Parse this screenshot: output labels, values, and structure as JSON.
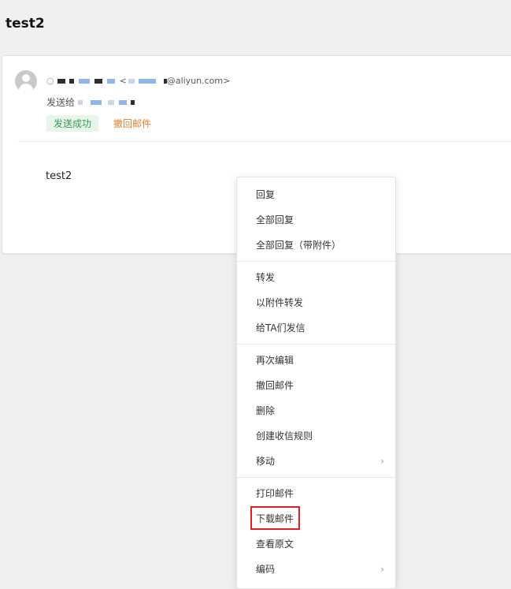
{
  "page": {
    "title": "test2"
  },
  "mail": {
    "sender_prefix": "○",
    "sender_domain": "@aliyun.com>",
    "sender_open_bracket": "<",
    "recipient_prefix": "发送给",
    "status": "发送成功",
    "recall": "撤回邮件",
    "body": "test2"
  },
  "menu": {
    "items": [
      {
        "label": "回复"
      },
      {
        "label": "全部回复"
      },
      {
        "label": "全部回复（带附件）"
      },
      {
        "label": "转发"
      },
      {
        "label": "以附件转发"
      },
      {
        "label": "给TA们发信"
      },
      {
        "label": "再次编辑"
      },
      {
        "label": "撤回邮件"
      },
      {
        "label": "删除"
      },
      {
        "label": "创建收信规则"
      },
      {
        "label": "移动",
        "submenu_arrow": "›"
      },
      {
        "label": "打印邮件"
      },
      {
        "label": "下载邮件"
      },
      {
        "label": "查看原文"
      },
      {
        "label": "编码",
        "submenu_arrow": "›"
      }
    ]
  },
  "colors": {
    "status_green": "#3a9a52",
    "recall_orange": "#e0802f",
    "highlight_red": "#e02020"
  }
}
